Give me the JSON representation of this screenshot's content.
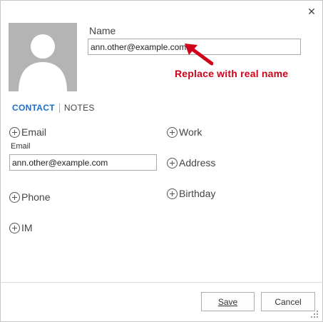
{
  "dialog": {
    "close_icon": "close-icon"
  },
  "header": {
    "name_label": "Name",
    "name_value": "ann.other@example.com"
  },
  "annotation": {
    "text": "Replace with real name",
    "color": "#d0021b"
  },
  "tabs": {
    "contact": "CONTACT",
    "notes": "NOTES",
    "active_color": "#1e6ec8"
  },
  "fields": {
    "email_add": "Email",
    "email_label": "Email",
    "email_value": "ann.other@example.com",
    "phone_add": "Phone",
    "im_add": "IM",
    "work_add": "Work",
    "address_add": "Address",
    "birthday_add": "Birthday"
  },
  "footer": {
    "save_label": "Save",
    "cancel_label": "Cancel"
  }
}
